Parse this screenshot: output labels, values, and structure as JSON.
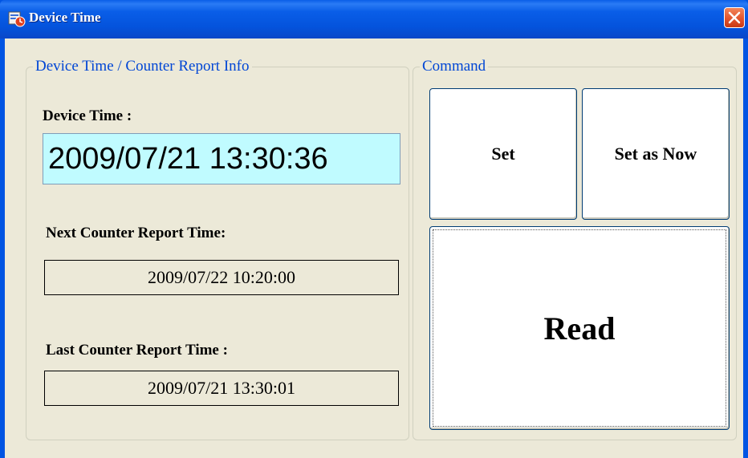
{
  "window": {
    "title": "Device Time",
    "app_icon": "device-app-icon",
    "close_icon": "close-icon"
  },
  "info_group": {
    "title": "Device Time / Counter Report Info",
    "device_time_label": "Device Time :",
    "device_time_value": "2009/07/21 13:30:36",
    "next_report_label": "Next Counter Report Time:",
    "next_report_value": "2009/07/22 10:20:00",
    "last_report_label": "Last Counter Report Time :",
    "last_report_value": "2009/07/21 13:30:01"
  },
  "command_group": {
    "title": "Command",
    "set_label": "Set",
    "set_now_label": "Set as Now",
    "read_label": "Read"
  },
  "colors": {
    "title_bar": "#0a5ee8",
    "device_time_bg": "#c0fbff",
    "group_title": "#0046d5",
    "client_bg": "#ece9d8"
  }
}
